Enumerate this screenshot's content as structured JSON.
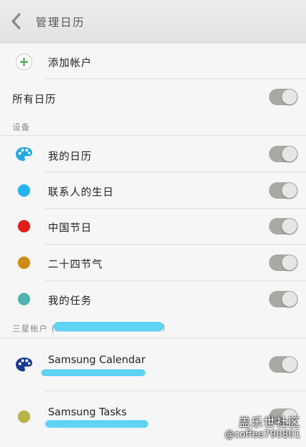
{
  "header": {
    "title": "管理日历"
  },
  "add_account": {
    "label": "添加帐户"
  },
  "all_calendars": {
    "label": "所有日历",
    "enabled": true
  },
  "device_section": {
    "title": "设备",
    "items": [
      {
        "label": "我的日历",
        "color": "#29a8e0",
        "icon": "palette-icon",
        "enabled": true
      },
      {
        "label": "联系人的生日",
        "color": "#25b3ef",
        "icon": "circle",
        "enabled": true
      },
      {
        "label": "中国节日",
        "color": "#e21b1b",
        "icon": "circle",
        "enabled": true
      },
      {
        "label": "二十四节气",
        "color": "#cc8b12",
        "icon": "circle",
        "enabled": true
      },
      {
        "label": "我的任务",
        "color": "#4fb3b0",
        "icon": "circle",
        "enabled": true
      }
    ]
  },
  "samsung_section": {
    "title": "三星帐户 (",
    "title_suffix": ")",
    "items": [
      {
        "label": "Samsung Calendar",
        "color": "#1b3a8f",
        "icon": "palette-icon",
        "enabled": true
      },
      {
        "label": "Samsung Tasks",
        "color": "#b7b446",
        "icon": "circle",
        "enabled": true
      }
    ]
  },
  "watermark": {
    "line1": "盖乐世社区",
    "line2": "@coffee790801"
  }
}
